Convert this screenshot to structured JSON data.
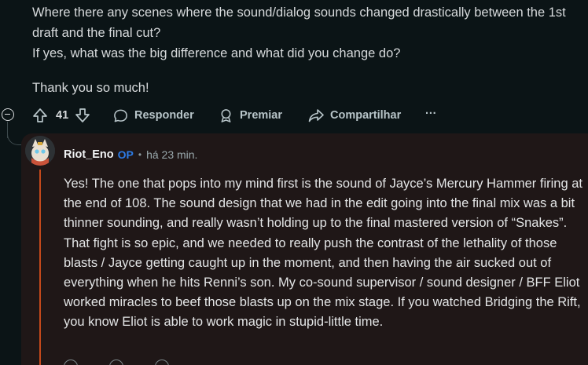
{
  "parent_comment": {
    "lines": [
      "Where there any scenes where the sound/dialog sounds changed drastically between the 1st draft and the final cut?",
      "If yes, what was the big difference and what did you change do?"
    ],
    "closing": "Thank you so much!"
  },
  "actions": {
    "collapse_icon": "minus-circle-icon",
    "upvote_icon": "arrow-up-icon",
    "vote_count": "41",
    "downvote_icon": "arrow-down-icon",
    "reply_label": "Responder",
    "award_label": "Premiar",
    "share_label": "Compartilhar",
    "more_label": "···"
  },
  "reply": {
    "username": "Riot_Eno",
    "op_badge": "OP",
    "separator": "•",
    "time": "há 23 min.",
    "body": "Yes! The one that pops into my mind first is the sound of Jayce’s Mercury Hammer firing at the end of 108. The sound design that we had in the edit going into the final mix was a bit thinner sounding, and really wasn’t holding up to the final mastered version of “Snakes”. That fight is so epic, and we needed to really push the contrast of the lethality of those blasts / Jayce getting caught up in the moment, and then having the air sucked out of everything when he hits Renni’s son. My co-sound supervisor / sound designer / BFF Eliot worked miracles to beef those blasts up on the mix stage. If you watched Bridging the Rift, you know Eliot is able to work magic in stupid-little time."
  },
  "colors": {
    "background": "#0b1416",
    "reply_background": "#1f1717",
    "op_badge": "#2c7be5",
    "thread_accent": "#c4491b"
  }
}
